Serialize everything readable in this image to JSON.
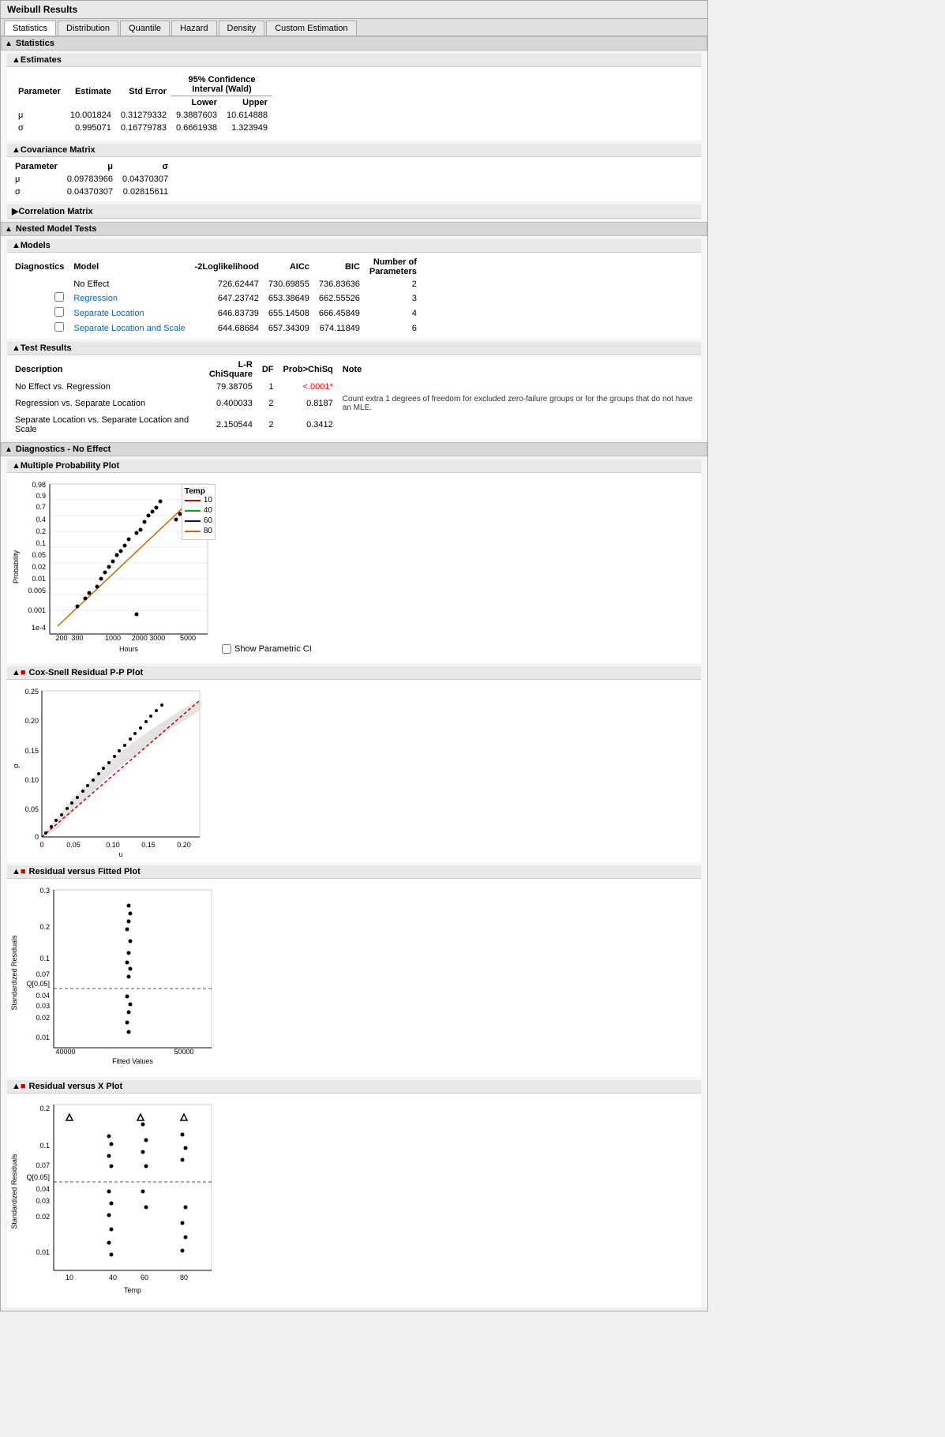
{
  "window": {
    "title": "Weibull Results"
  },
  "tabs": [
    {
      "label": "Statistics",
      "active": true
    },
    {
      "label": "Distribution",
      "active": false
    },
    {
      "label": "Quantile",
      "active": false
    },
    {
      "label": "Hazard",
      "active": false
    },
    {
      "label": "Density",
      "active": false
    },
    {
      "label": "Custom Estimation",
      "active": false
    }
  ],
  "statistics_section": {
    "title": "Statistics",
    "estimates": {
      "title": "Estimates",
      "header_row1": [
        "",
        "",
        "95% Confidence"
      ],
      "header_row2": [
        "",
        "",
        "Interval (Wald)"
      ],
      "headers": [
        "Parameter",
        "Estimate",
        "Std Error",
        "Lower",
        "Upper"
      ],
      "rows": [
        {
          "param": "μ",
          "estimate": "10.001824",
          "std_error": "0.31279332",
          "lower": "9.3887603",
          "upper": "10.614888"
        },
        {
          "param": "σ",
          "estimate": "0.995071",
          "std_error": "0.16779783",
          "lower": "0.6661938",
          "upper": "1.323949"
        }
      ]
    },
    "covariance": {
      "title": "Covariance Matrix",
      "headers": [
        "Parameter",
        "μ",
        "σ"
      ],
      "rows": [
        {
          "param": "μ",
          "mu": "0.09783966",
          "sigma": "0.04370307"
        },
        {
          "param": "σ",
          "mu": "0.04370307",
          "sigma": "0.02815611"
        }
      ]
    },
    "correlation": {
      "title": "Correlation Matrix"
    },
    "nested_model": {
      "title": "Nested Model Tests",
      "models": {
        "title": "Models",
        "headers": [
          "Diagnostics",
          "Model",
          "-2Loglikelihood",
          "AICc",
          "BIC",
          "Number of Parameters"
        ],
        "rows": [
          {
            "model": "No Effect",
            "log": "726.62447",
            "aicc": "730.69855",
            "bic": "736.83636",
            "params": "2",
            "link": false,
            "checked": null
          },
          {
            "model": "Regression",
            "log": "647.23742",
            "aicc": "653.38649",
            "bic": "662.55526",
            "params": "3",
            "link": true,
            "checked": false
          },
          {
            "model": "Separate Location",
            "log": "646.83739",
            "aicc": "655.14508",
            "bic": "666.45849",
            "params": "4",
            "link": true,
            "checked": false
          },
          {
            "model": "Separate Location and Scale",
            "log": "644.68684",
            "aicc": "657.34309",
            "bic": "674.11849",
            "params": "6",
            "link": true,
            "checked": false
          }
        ]
      },
      "test_results": {
        "title": "Test Results",
        "headers": [
          "Description",
          "L-R ChiSquare",
          "DF",
          "Prob>ChiSq",
          "Note"
        ],
        "rows": [
          {
            "desc": "No Effect vs. Regression",
            "chi": "79.38705",
            "df": "1",
            "prob": "<.0001*",
            "note": "",
            "prob_red": true
          },
          {
            "desc": "Regression vs. Separate Location",
            "chi": "0.400033",
            "df": "2",
            "prob": "0.8187",
            "note": "Count extra 1 degrees of freedom for excluded zero-failure groups or for the groups that do not have an MLE.",
            "prob_red": false
          },
          {
            "desc": "Separate Location vs. Separate Location and Scale",
            "chi": "2.150544",
            "df": "2",
            "prob": "0.3412",
            "note": "",
            "prob_red": false
          }
        ]
      }
    },
    "diagnostics": {
      "title": "Diagnostics - No Effect",
      "prob_plot": {
        "title": "Multiple Probability Plot",
        "legend": {
          "title": "Temp",
          "items": [
            {
              "label": "10",
              "color": "#cc0000"
            },
            {
              "label": "40",
              "color": "#00aa00"
            },
            {
              "label": "60",
              "color": "#0000cc"
            },
            {
              "label": "80",
              "color": "#cc6600"
            }
          ]
        },
        "x_label": "Hours",
        "y_label": "Probability",
        "show_ci_label": "Show Parametric CI"
      },
      "cox_snell": {
        "title": "Cox-Snell Residual P-P Plot",
        "x_label": "u",
        "y_label": "p"
      },
      "residual_fitted": {
        "title": "Residual versus Fitted Plot",
        "x_label": "Fitted Values",
        "y_label": "Standardized Residuals"
      },
      "residual_x": {
        "title": "Residual versus X Plot",
        "x_label": "Temp",
        "y_label": "Standardized Residuals"
      }
    }
  },
  "icons": {
    "triangle_down": "▲",
    "triangle_right": "▶",
    "collapse": "▴"
  }
}
